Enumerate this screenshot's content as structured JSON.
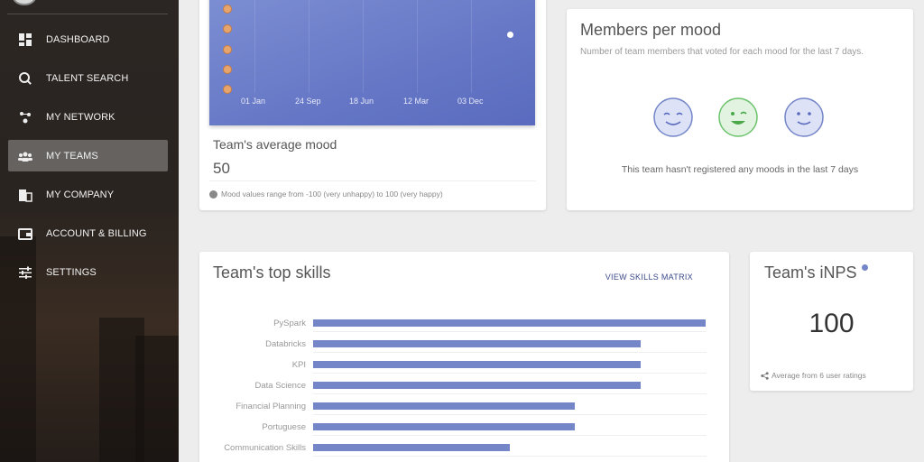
{
  "sidebar": {
    "items": [
      {
        "label": "DASHBOARD",
        "icon": "dashboard-icon"
      },
      {
        "label": "TALENT SEARCH",
        "icon": "talent-search-icon"
      },
      {
        "label": "MY NETWORK",
        "icon": "network-icon"
      },
      {
        "label": "MY TEAMS",
        "icon": "teams-icon",
        "active": true
      },
      {
        "label": "MY COMPANY",
        "icon": "company-icon"
      },
      {
        "label": "ACCOUNT & BILLING",
        "icon": "wallet-icon"
      },
      {
        "label": "SETTINGS",
        "icon": "settings-sliders-icon"
      }
    ]
  },
  "mood": {
    "chart_ticks": [
      "01 Jan",
      "24 Sep",
      "18 Jun",
      "12 Mar",
      "03 Dec"
    ],
    "title": "Team's average mood",
    "value": "50",
    "note": "Mood values range from -100 (very unhappy) to 100 (very happy)"
  },
  "members": {
    "title": "Members per mood",
    "subtitle": "Number of team members that voted for each mood for the last 7 days.",
    "empty": "This team hasn't registered any moods in the last 7 days",
    "faces": [
      "happy-face-icon",
      "winking-face-icon",
      "smiling-face-icon"
    ]
  },
  "skills": {
    "title": "Team's top skills",
    "matrix_link": "VIEW SKILLS MATRIX",
    "chart_data": {
      "type": "bar",
      "orientation": "horizontal",
      "categories": [
        "PySpark",
        "Databricks",
        "KPI",
        "Data Science",
        "Financial Planning",
        "Portuguese",
        "Communication Skills"
      ],
      "values": [
        6,
        5,
        5,
        5,
        4,
        4,
        3
      ]
    }
  },
  "inps": {
    "title": "Team's iNPS",
    "value": "100",
    "footer": "Average from 6 user ratings"
  },
  "colors": {
    "accent": "#7486c8",
    "chart_bg": "#6677c6",
    "sidebar_bg": "#2a2420"
  }
}
